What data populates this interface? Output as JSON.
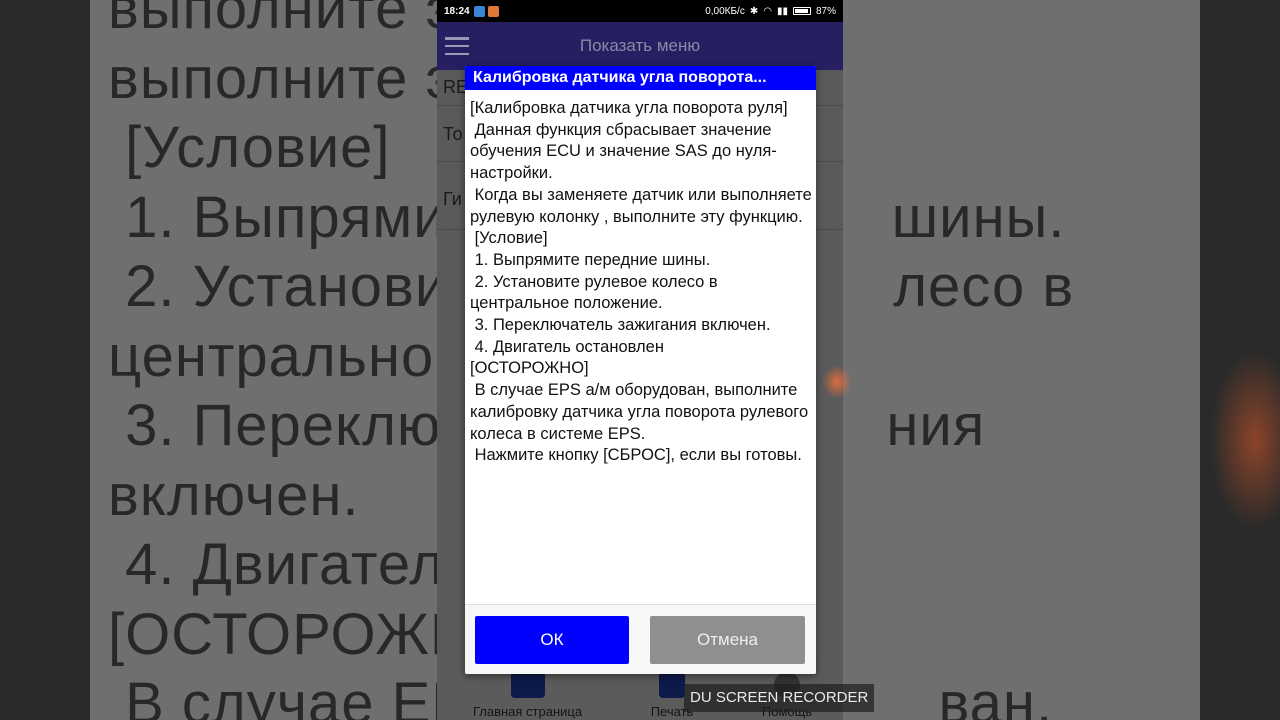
{
  "background": {
    "lines": [
      "выполните э",
      "выполните эт",
      " [Условие]",
      " 1. Выпрями                          шины.",
      " 2. Установи                          лесо в",
      "центрально",
      " 3. Переклю                          ния",
      "включен.",
      " 4. Двигател",
      "[ОСТОРОЖН",
      " В случае EPS                         ван,"
    ]
  },
  "status_bar": {
    "time": "18:24",
    "network_speed": "0,00КБ/с",
    "battery": "87%"
  },
  "app_bar": {
    "title": "Показать меню",
    "menu_icon": "hamburger-menu-icon"
  },
  "list": {
    "items": [
      "RE",
      "То",
      "Ги"
    ]
  },
  "bottom_nav": {
    "items": [
      {
        "label": "Главная страница",
        "icon": "car-icon"
      },
      {
        "label": "Печать",
        "icon": "print-icon"
      },
      {
        "label": "Помощь",
        "icon": "help-icon"
      }
    ]
  },
  "dialog": {
    "title": "Калибровка датчика угла поворота...",
    "body": "[Калибровка датчика угла поворота руля]\n Данная функция сбрасывает значение обучения ECU и значение SAS до нуля-настройки.\n Когда вы заменяете датчик или выполняете рулевую колонку , выполните эту функцию.\n [Условие]\n 1. Выпрямите передние шины.\n 2. Установите рулевое колесо в центральное положение.\n 3. Переключатель зажигания включен.\n 4. Двигатель остановлен\n[ОСТОРОЖНО]\n В случае EPS а/м оборудован, выполните калибровку датчика угла поворота рулевого колеса в системе EPS.\n Нажмите кнопку [СБРОС], если вы готовы.",
    "ok_label": "ОК",
    "cancel_label": "Отмена"
  },
  "watermark": "DU SCREEN RECORDER",
  "colors": {
    "app_bar": "#261f62",
    "dialog_title": "#0000ff",
    "ok_button": "#0000ff",
    "cancel_button": "#8f8f8f"
  }
}
